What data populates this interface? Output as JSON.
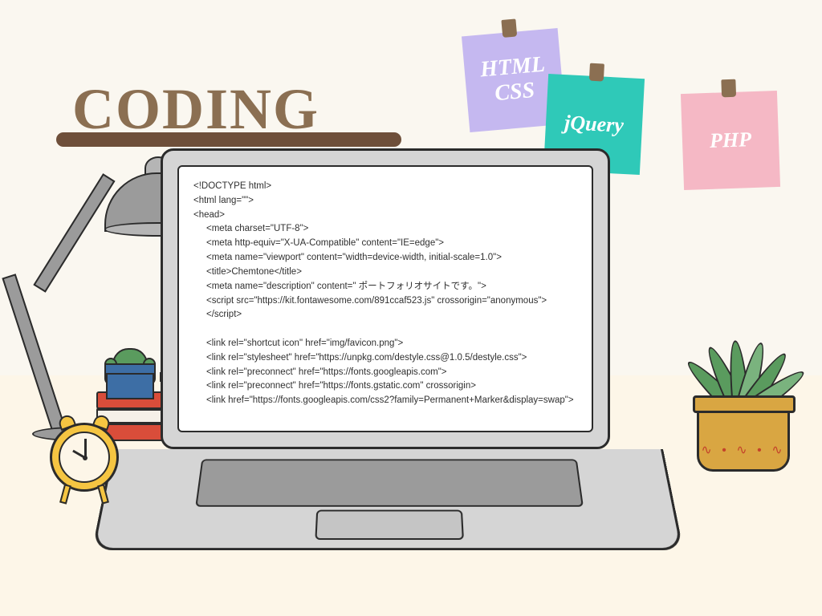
{
  "shelf_title": "CODING",
  "notes": {
    "n1_line1": "HTML",
    "n1_line2": "CSS",
    "n2": "jQuery",
    "n3": "PHP"
  },
  "code_lines": [
    "<!DOCTYPE html>",
    "<html lang=\"\">",
    "<head>",
    "  <meta charset=\"UTF-8\">",
    "  <meta http-equiv=\"X-UA-Compatible\" content=\"IE=edge\">",
    "  <meta name=\"viewport\" content=\"width=device-width, initial-scale=1.0\">",
    "  <title>Chemtone</title>",
    "  <meta name=\"description\" content=\" ポートフォリオサイトです。\">",
    "  <script src=\"https://kit.fontawesome.com/891ccaf523.js\" crossorigin=\"anonymous\"></script>",
    "",
    "  <link rel=\"shortcut icon\" href=\"img/favicon.png\">",
    "  <link rel=\"stylesheet\" href=\"https://unpkg.com/destyle.css@1.0.5/destyle.css\">",
    "  <link rel=\"preconnect\" href=\"https://fonts.googleapis.com\">",
    "  <link rel=\"preconnect\" href=\"https://fonts.gstatic.com\" crossorigin>",
    "  <link href=\"https://fonts.googleapis.com/css2?family=Permanent+Marker&display=swap\">"
  ]
}
